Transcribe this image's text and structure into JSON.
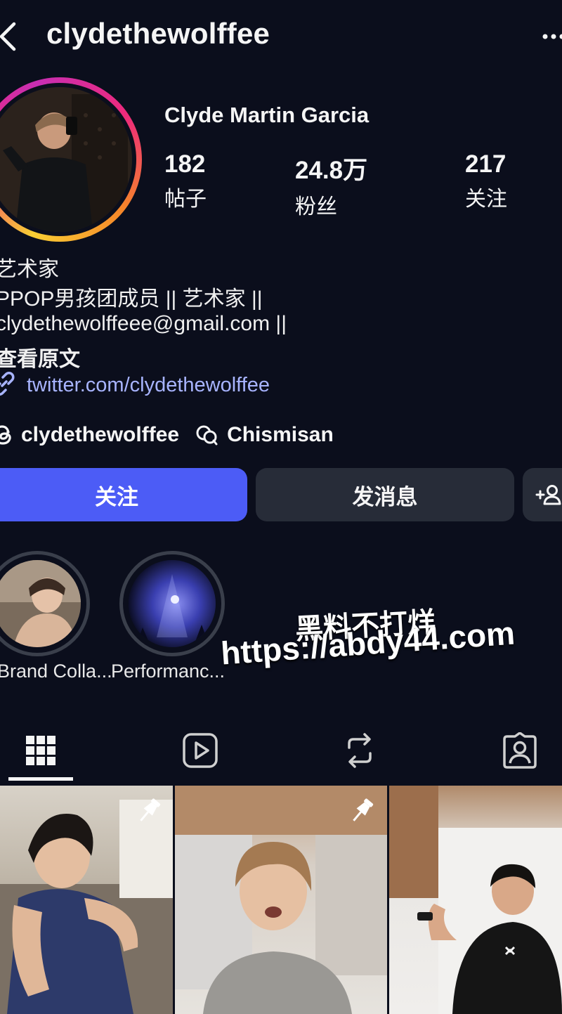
{
  "header": {
    "username": "clydethewolffee",
    "back_icon": "chevron-left-icon",
    "more_icon": "more-dots-icon"
  },
  "profile": {
    "display_name": "Clyde Martin Garcia",
    "stats": {
      "posts": {
        "value": "182",
        "label": "帖子"
      },
      "followers": {
        "value": "24.8万",
        "label": "粉丝"
      },
      "following": {
        "value": "217",
        "label": "关注"
      }
    },
    "story_ring_colors": [
      "#f9ce34",
      "#ee2a7b",
      "#c82eb3"
    ]
  },
  "bio": {
    "line1": "艺术家",
    "line2": "PPOP男孩团成员 || 艺术家 ||",
    "line3": "clydethewolffeee@gmail.com ||",
    "translate": "查看原文",
    "link": "twitter.com/clydethewolffee"
  },
  "chips": {
    "threads": "clydethewolffee",
    "channel": "Chismisan"
  },
  "buttons": {
    "follow": "关注",
    "message": "发消息",
    "add_user_icon": "add-user-icon"
  },
  "highlights": [
    {
      "label": "Brand Colla..."
    },
    {
      "label": "Performanc..."
    }
  ],
  "watermark": {
    "line1": "黑料不打烊",
    "line2": "https://abdy44.com"
  },
  "tabs": [
    {
      "icon": "grid-icon",
      "active": true
    },
    {
      "icon": "reels-icon",
      "active": false
    },
    {
      "icon": "repost-icon",
      "active": false
    },
    {
      "icon": "tagged-icon",
      "active": false
    }
  ],
  "colors": {
    "background": "#0b0e1c",
    "follow_button": "#4c5cf6",
    "secondary_button": "#272c38",
    "link": "#a8b4ff"
  }
}
